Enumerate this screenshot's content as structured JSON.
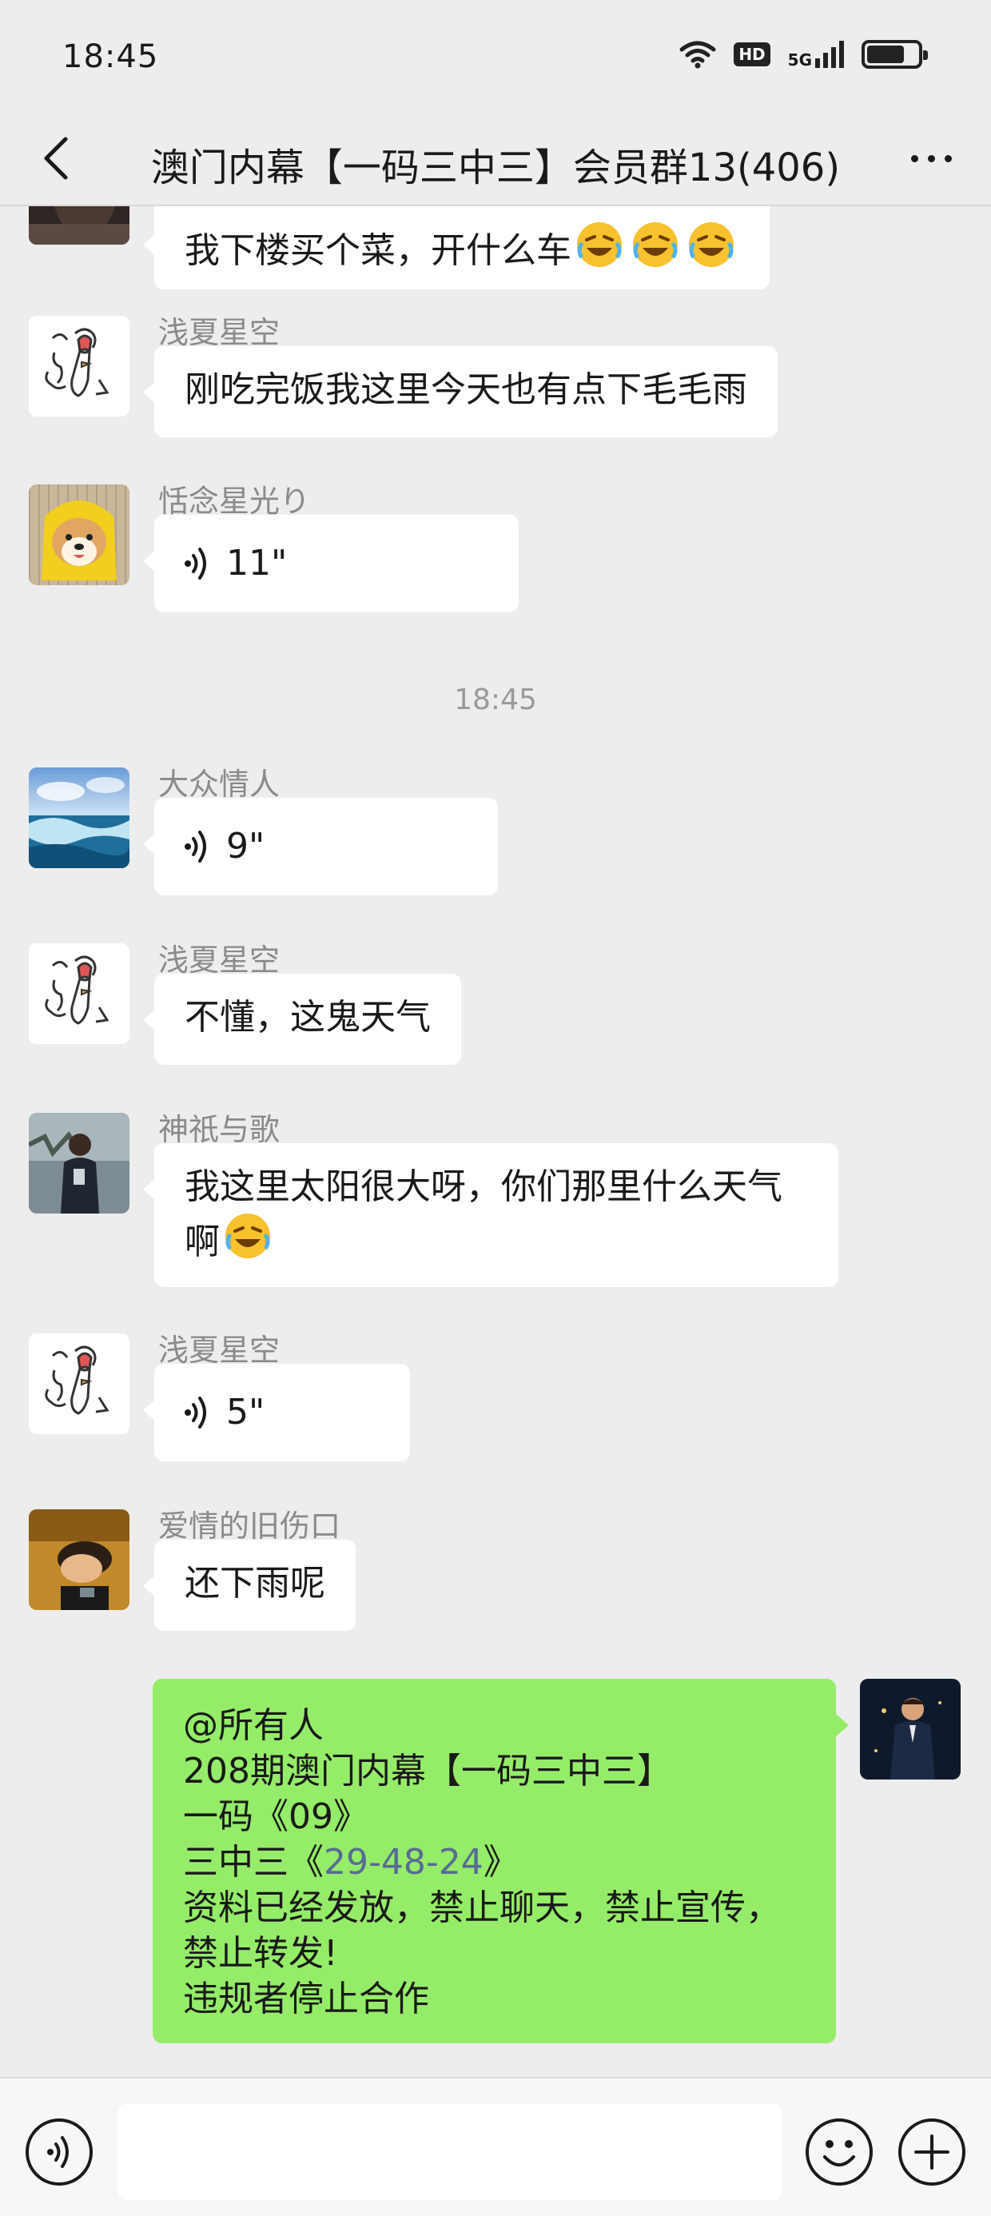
{
  "status_bar": {
    "time": "18:45",
    "hd": "HD",
    "network": "5G"
  },
  "nav": {
    "title": "澳门内幕【一码三中三】会员群13(406)"
  },
  "messages": [
    {
      "type": "text",
      "text_before": "我下楼买个菜，开什么车",
      "emoji": "rofl",
      "emoji_count": 3
    },
    {
      "sender": "浅夏星空",
      "avatar": "rooster-cartoon",
      "type": "text",
      "text": "刚吃完饭我这里今天也有点下毛毛雨"
    },
    {
      "sender": "恬念星光り",
      "avatar": "shiba-in-yellow-hood",
      "type": "voice",
      "duration": "11\""
    },
    {
      "sender": "大众情人",
      "avatar": "ocean-wave",
      "type": "voice",
      "duration": "9\""
    },
    {
      "sender": "浅夏星空",
      "avatar": "rooster-cartoon",
      "type": "text",
      "text": "不懂，这鬼天气"
    },
    {
      "sender": "神祇与歌",
      "avatar": "person-outdoors",
      "type": "text",
      "line1": "我这里太阳很大呀，你们那里什么天气",
      "line2": "啊",
      "emoji": "rofl"
    },
    {
      "sender": "浅夏星空",
      "avatar": "rooster-cartoon",
      "type": "voice",
      "duration": "5\""
    },
    {
      "sender": "爱情的旧伤口",
      "avatar": "person-lying-down",
      "type": "text",
      "text": "还下雨呢"
    }
  ],
  "time_divider": "18:45",
  "my_message": {
    "avatar": "man-in-suit",
    "line1": "@所有人",
    "line2": "208期澳门内幕【一码三中三】",
    "line3": "一码《09》",
    "line4_prefix": "三中三《",
    "line4_numbers": "29-48-24",
    "line4_suffix": "》",
    "line5": "资料已经发放，禁止聊天，禁止宣传，",
    "line6": "禁止转发!",
    "line7": "违规者停止合作"
  },
  "input_bar": {
    "voice_icon": "voice-toggle-icon",
    "emoji_icon": "smiley-icon",
    "plus_icon": "plus-icon",
    "input_value": ""
  },
  "colors": {
    "background": "#ededed",
    "my_bubble": "#95ec69",
    "link": "#576b95",
    "sender_name": "#8a8a8a"
  }
}
